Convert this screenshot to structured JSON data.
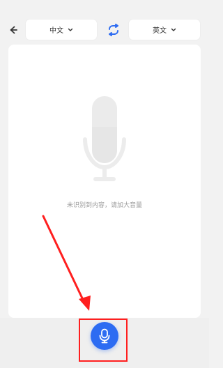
{
  "header": {
    "source_language": "中文",
    "target_language": "英文"
  },
  "main": {
    "empty_message": "未识别到内容，请加大音量"
  },
  "icons": {
    "back": "back-arrow-icon",
    "chevron": "chevron-down-icon",
    "swap": "swap-icon",
    "mic": "microphone-icon"
  },
  "colors": {
    "accent_blue": "#2d6cf2",
    "annotation_red": "#ff1f1f",
    "muted_text": "#9a9a9a"
  }
}
